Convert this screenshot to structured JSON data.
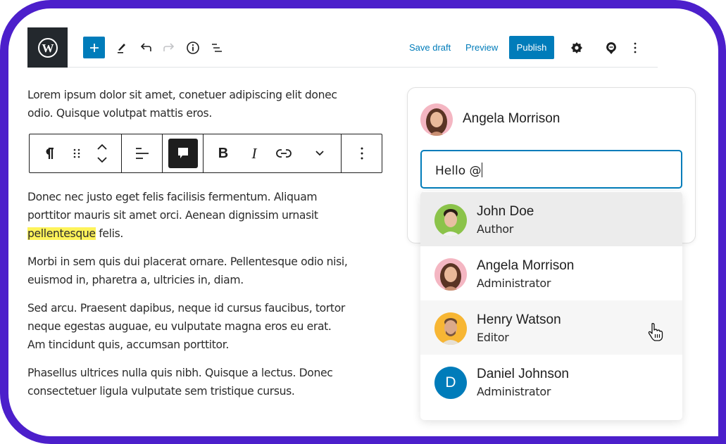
{
  "toolbar": {
    "logo_icon": "wordpress-icon",
    "add_block_icon": "plus-icon",
    "tools_icon": "pencil-icon",
    "undo_icon": "undo-icon",
    "redo_icon": "redo-icon",
    "details_icon": "info-icon",
    "list_view_icon": "list-view-icon",
    "save_draft_label": "Save draft",
    "preview_label": "Preview",
    "publish_label": "Publish",
    "settings_icon": "gear-icon",
    "comments_icon": "comment-pin-icon",
    "options_icon": "more-vertical-icon",
    "accent_color": "#007cba"
  },
  "block_toolbar": {
    "items": [
      {
        "name": "paragraph",
        "icon": "pilcrow-icon"
      },
      {
        "name": "drag",
        "icon": "drag-handle-icon"
      },
      {
        "name": "move",
        "icon": "move-up-down-icon"
      },
      {
        "name": "align",
        "icon": "align-left-icon"
      },
      {
        "name": "comment",
        "icon": "comment-icon",
        "active": true
      },
      {
        "name": "bold",
        "label": "B"
      },
      {
        "name": "italic",
        "label": "I"
      },
      {
        "name": "link",
        "icon": "link-icon"
      },
      {
        "name": "more-formats",
        "icon": "chevron-down-icon"
      },
      {
        "name": "options",
        "icon": "more-vertical-icon"
      }
    ]
  },
  "content": {
    "paragraphs": [
      "Lorem ipsum dolor sit amet, conetuer adipiscing elit donec odio. Quisque volutpat mattis eros.",
      "Donec nec justo eget felis facilisis fermentum. Aliquam porttitor mauris sit amet orci. Aenean dignissim urnasit",
      "Morbi in sem quis dui placerat ornare. Pellentesque odio nisi, euismod in, pharetra a, ultricies in, diam.",
      "Sed arcu. Praesent dapibus, neque id cursus faucibus, tortor neque egestas auguae, eu vulputate magna eros eu erat. Am tincidunt quis, accumsan porttitor.",
      "Phasellus ultrices nulla quis nibh. Quisque a lectus. Donec consectetuer ligula vulputate sem tristique cursus."
    ],
    "para1_lines": [
      "Lorem ipsum dolor sit amet, conetuer adipiscing elit donec",
      "odio. Quisque volutpat mattis eros."
    ],
    "para2_lines": [
      "Donec nec justo eget felis facilisis fermentum. Aliquam",
      "porttitor mauris sit amet orci. Aenean dignissim urnasit"
    ],
    "highlighted_word": "pellentesque",
    "after_highlight": " felis.",
    "highlight_color": "#fef35a",
    "para3_lines": [
      "Morbi in sem quis dui placerat ornare. Pellentesque odio nisi,",
      "euismod in, pharetra a, ultricies in, diam."
    ],
    "para4_lines": [
      "Sed arcu. Praesent dapibus, neque id cursus faucibus, tortor",
      "neque egestas auguae, eu vulputate magna eros eu erat.",
      "Am tincidunt quis, accumsan porttitor."
    ],
    "para5_lines": [
      "Phasellus ultrices nulla quis nibh. Quisque a lectus. Donec",
      "consectetuer ligula vulputate sem tristique cursus."
    ]
  },
  "comment_panel": {
    "author": "Angela Morrison",
    "input_value": "Hello @"
  },
  "mentions": [
    {
      "name": "John Doe",
      "role": "Author",
      "avatar_color": "#8bc34a",
      "state": "selected"
    },
    {
      "name": "Angela Morrison",
      "role": "Administrator",
      "avatar_color": "#f4b6c2",
      "state": "normal"
    },
    {
      "name": "Henry Watson",
      "role": "Editor",
      "avatar_color": "#f7b634",
      "state": "hover"
    },
    {
      "name": "Daniel Johnson",
      "role": "Administrator",
      "avatar_color": "#007cba",
      "initial": "D",
      "state": "normal"
    }
  ],
  "frame_color": "#4c1fcb"
}
